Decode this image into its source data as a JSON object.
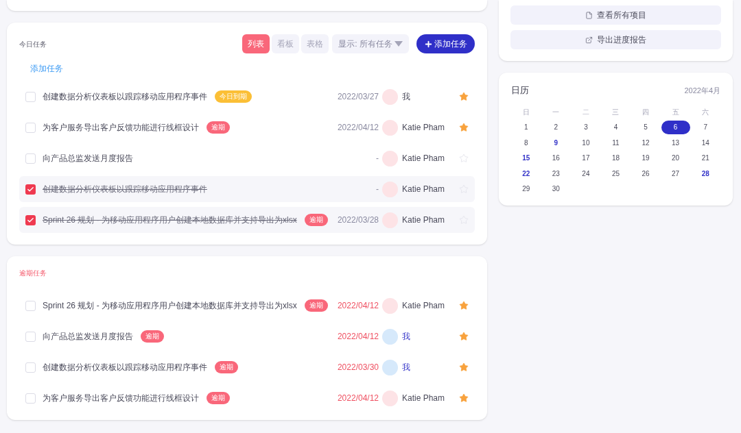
{
  "side_actions": [
    {
      "kind": "file",
      "label": "查看所有项目"
    },
    {
      "kind": "external",
      "label": "导出进度报告"
    }
  ],
  "today": {
    "title": "今日任务",
    "views": [
      {
        "label": "列表",
        "selected": true
      },
      {
        "label": "看板",
        "selected": false
      },
      {
        "label": "表格",
        "selected": false
      }
    ],
    "filter": "显示: 所有任务",
    "add_button": "添加任务",
    "add_link": "添加任务",
    "tasks": [
      {
        "checked": false,
        "title": "创建数据分析仪表板以跟踪移动应用程序事件",
        "tag": {
          "kind": "today",
          "label": "今日到期"
        },
        "date": "2022/03/27",
        "overdue": false,
        "assignee": {
          "name": "我",
          "kind": "other"
        },
        "starred": true
      },
      {
        "checked": false,
        "title": "为客户服务导出客户反馈功能进行线框设计",
        "tag": {
          "kind": "overdue",
          "label": "逾期"
        },
        "date": "2022/04/12",
        "overdue": false,
        "assignee": {
          "name": "Katie Pham",
          "kind": "other"
        },
        "starred": true
      },
      {
        "checked": false,
        "title": "向产品总监发送月度报告",
        "date": "-",
        "overdue": false,
        "assignee": {
          "name": "Katie Pham",
          "kind": "other"
        },
        "starred": false
      },
      {
        "checked": true,
        "title": "创建数据分析仪表板以跟踪移动应用程序事件",
        "date": "-",
        "overdue": false,
        "assignee": {
          "name": "Katie Pham",
          "kind": "other"
        },
        "starred": false
      },
      {
        "checked": true,
        "title": "Sprint 26 规划 - 为移动应用程序用户创建本地数据库并支持导出为xlsx",
        "tag": {
          "kind": "overdue",
          "label": "逾期"
        },
        "date": "2022/03/28",
        "overdue": false,
        "assignee": {
          "name": "Katie Pham",
          "kind": "other"
        },
        "starred": false
      }
    ]
  },
  "overdue": {
    "title": "逾期任务",
    "tasks": [
      {
        "checked": false,
        "title": "Sprint 26 规划 - 为移动应用程序用户创建本地数据库并支持导出为xlsx",
        "tag": {
          "kind": "overdue",
          "label": "逾期"
        },
        "date": "2022/04/12",
        "overdue": true,
        "assignee": {
          "name": "Katie Pham",
          "kind": "other"
        },
        "starred": true
      },
      {
        "checked": false,
        "title": "向产品总监发送月度报告",
        "tag": {
          "kind": "overdue",
          "label": "逾期"
        },
        "date": "2022/04/12",
        "overdue": true,
        "assignee": {
          "name": "我",
          "kind": "self"
        },
        "starred": true
      },
      {
        "checked": false,
        "title": "创建数据分析仪表板以跟踪移动应用程序事件",
        "tag": {
          "kind": "overdue",
          "label": "逾期"
        },
        "date": "2022/03/30",
        "overdue": true,
        "assignee": {
          "name": "我",
          "kind": "self"
        },
        "starred": true
      },
      {
        "checked": false,
        "title": "为客户服务导出客户反馈功能进行线框设计",
        "tag": {
          "kind": "overdue",
          "label": "逾期"
        },
        "date": "2022/04/12",
        "overdue": true,
        "assignee": {
          "name": "Katie Pham",
          "kind": "other"
        },
        "starred": true
      }
    ]
  },
  "calendar": {
    "title": "日历",
    "month": "2022年4月",
    "weekdays": [
      "日",
      "一",
      "二",
      "三",
      "四",
      "五",
      "六"
    ],
    "days": [
      {
        "day": "1",
        "selected": false,
        "marked": false
      },
      {
        "day": "2",
        "selected": false,
        "marked": false
      },
      {
        "day": "3",
        "selected": false,
        "marked": false
      },
      {
        "day": "4",
        "selected": false,
        "marked": false
      },
      {
        "day": "5",
        "selected": false,
        "marked": false
      },
      {
        "day": "6",
        "selected": true,
        "marked": false
      },
      {
        "day": "7",
        "selected": false,
        "marked": false
      },
      {
        "day": "8",
        "selected": false,
        "marked": false
      },
      {
        "day": "9",
        "selected": false,
        "marked": true
      },
      {
        "day": "10",
        "selected": false,
        "marked": false
      },
      {
        "day": "11",
        "selected": false,
        "marked": false
      },
      {
        "day": "12",
        "selected": false,
        "marked": false
      },
      {
        "day": "13",
        "selected": false,
        "marked": false
      },
      {
        "day": "14",
        "selected": false,
        "marked": false
      },
      {
        "day": "15",
        "selected": false,
        "marked": true
      },
      {
        "day": "16",
        "selected": false,
        "marked": false
      },
      {
        "day": "17",
        "selected": false,
        "marked": false
      },
      {
        "day": "18",
        "selected": false,
        "marked": false
      },
      {
        "day": "19",
        "selected": false,
        "marked": false
      },
      {
        "day": "20",
        "selected": false,
        "marked": false
      },
      {
        "day": "21",
        "selected": false,
        "marked": false
      },
      {
        "day": "22",
        "selected": false,
        "marked": true
      },
      {
        "day": "23",
        "selected": false,
        "marked": false
      },
      {
        "day": "24",
        "selected": false,
        "marked": false
      },
      {
        "day": "25",
        "selected": false,
        "marked": false
      },
      {
        "day": "26",
        "selected": false,
        "marked": false
      },
      {
        "day": "27",
        "selected": false,
        "marked": false
      },
      {
        "day": "28",
        "selected": false,
        "marked": true
      },
      {
        "day": "29",
        "selected": false,
        "marked": false
      },
      {
        "day": "30",
        "selected": false,
        "marked": false
      }
    ]
  }
}
